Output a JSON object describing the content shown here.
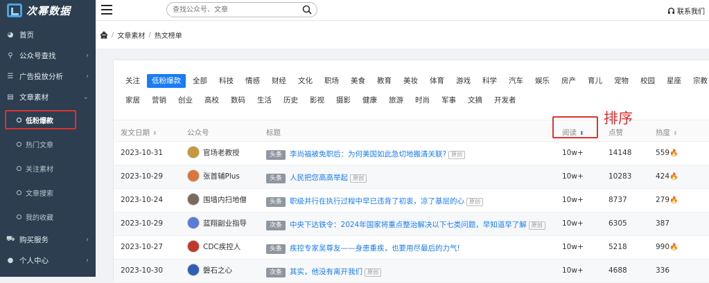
{
  "brand": {
    "name": "次幂数据"
  },
  "search": {
    "placeholder": "查找公众号、文章"
  },
  "topbar": {
    "contact_label": "联系我们"
  },
  "sidebar": {
    "items": [
      {
        "label": "首页",
        "icon": "dashboard-icon"
      },
      {
        "label": "公众号查找",
        "icon": "search-icon"
      },
      {
        "label": "广告投放分析",
        "icon": "list-icon"
      },
      {
        "label": "文章素材",
        "icon": "document-icon"
      }
    ],
    "sub_items": [
      {
        "label": "低粉爆款",
        "active": true
      },
      {
        "label": "热门文章"
      },
      {
        "label": "关注素材"
      },
      {
        "label": "文章搜索"
      },
      {
        "label": "我的收藏"
      }
    ],
    "bottom_items": [
      {
        "label": "购买服务",
        "icon": "cart-icon"
      },
      {
        "label": "个人中心",
        "icon": "user-icon"
      }
    ]
  },
  "breadcrumb": {
    "items": [
      "文章素材",
      "热文榜单"
    ]
  },
  "tags": {
    "row1": [
      "关注",
      "低粉爆款",
      "全部",
      "科技",
      "情感",
      "财经",
      "文化",
      "职场",
      "美食",
      "教育",
      "美妆",
      "体育",
      "游戏",
      "科学",
      "汽车",
      "娱乐",
      "房产",
      "育儿",
      "宠物",
      "校园",
      "星座",
      "宗教"
    ],
    "row2": [
      "家居",
      "营销",
      "创业",
      "高校",
      "数码",
      "生活",
      "历史",
      "影视",
      "摄影",
      "健康",
      "旅游",
      "时尚",
      "军事",
      "文摘",
      "开发者"
    ],
    "active": "低粉爆款"
  },
  "table": {
    "headers": {
      "date": "发文日期",
      "account": "公众号",
      "title": "标题",
      "reads": "阅读",
      "likes": "点赞",
      "heat": "热度"
    },
    "rows": [
      {
        "date": "2023-10-31",
        "account": "官场老教授",
        "badge": "头条",
        "title": "李尚福被免职后：为何美国如此急切地搬清关联?",
        "orig": "原创",
        "reads": "10w+",
        "likes": "14148",
        "heat": "559",
        "hot": true
      },
      {
        "date": "2023-10-29",
        "account": "张首辅Plus",
        "badge": "头条",
        "title": "人民把您高高举起",
        "orig": "原创",
        "reads": "10w+",
        "likes": "10283",
        "heat": "424",
        "hot": true
      },
      {
        "date": "2023-10-24",
        "account": "围墙内扫地僧",
        "badge": "头条",
        "title": "职级并行在执行过程中早已违背了初衷，凉了基层的心",
        "orig": "原创",
        "reads": "10w+",
        "likes": "8737",
        "heat": "279",
        "hot": true
      },
      {
        "date": "2023-10-29",
        "account": "蓝翔副业指导",
        "badge": "次条",
        "title": "中央下达铁令：2024年国家将重点整治解决以下七类问题，早知道早了解",
        "orig": "原创",
        "reads": "10w+",
        "likes": "6305",
        "heat": "387",
        "hot": false
      },
      {
        "date": "2023-10-27",
        "account": "CDC疾控人",
        "badge": "头条",
        "title": "疾控专家吴尊友——身患重疾，也要用尽最后的力气!",
        "orig": "",
        "reads": "10w+",
        "likes": "5218",
        "heat": "990",
        "hot": true
      },
      {
        "date": "2023-10-30",
        "account": "磐石之心",
        "badge": "次条",
        "title": "其实，他没有离开我们",
        "orig": "原创",
        "reads": "10w+",
        "likes": "4688",
        "heat": "336",
        "hot": false
      }
    ]
  },
  "annotation": {
    "text": "排序"
  },
  "colors": {
    "sidebar": "#2c3e50",
    "accent": "#1a7cf3",
    "highlight": "#e03131"
  }
}
